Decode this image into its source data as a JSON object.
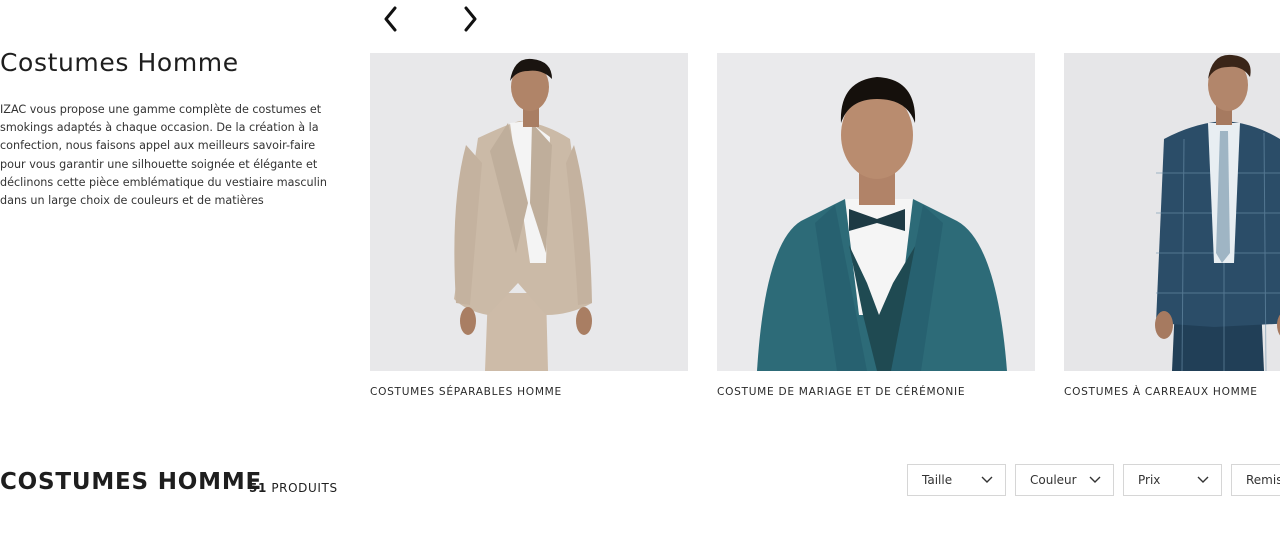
{
  "intro": {
    "title": "Costumes Homme",
    "description": "IZAC vous propose une gamme complète de costumes et smokings adaptés à chaque occasion. De la création à la confection, nous faisons appel aux meilleurs savoir-faire pour vous garantir une silhouette soignée et élégante et déclinons cette pièce emblématique du vestiaire masculin dans un large choix de couleurs et de matières"
  },
  "carousel": {
    "prev_icon": "chevron-left-icon",
    "next_icon": "chevron-right-icon",
    "cards": [
      {
        "label": "COSTUMES SÉPARABLES HOMME",
        "image": "beige-suit-photo"
      },
      {
        "label": "COSTUME DE MARIAGE ET DE CÉRÉMONIE",
        "image": "teal-suit-photo"
      },
      {
        "label": "COSTUMES À CARREAUX HOMME",
        "image": "navy-check-suit-photo"
      }
    ]
  },
  "listing": {
    "title": "COSTUMES HOMME",
    "count": "51",
    "count_suffix": "PRODUITS"
  },
  "filters": {
    "size": "Taille",
    "color": "Couleur",
    "price": "Prix",
    "discount": "Remise"
  },
  "colors": {
    "text": "#1e1e1e",
    "image_bg": "#e9e9eb",
    "border": "#d6d6d6"
  }
}
